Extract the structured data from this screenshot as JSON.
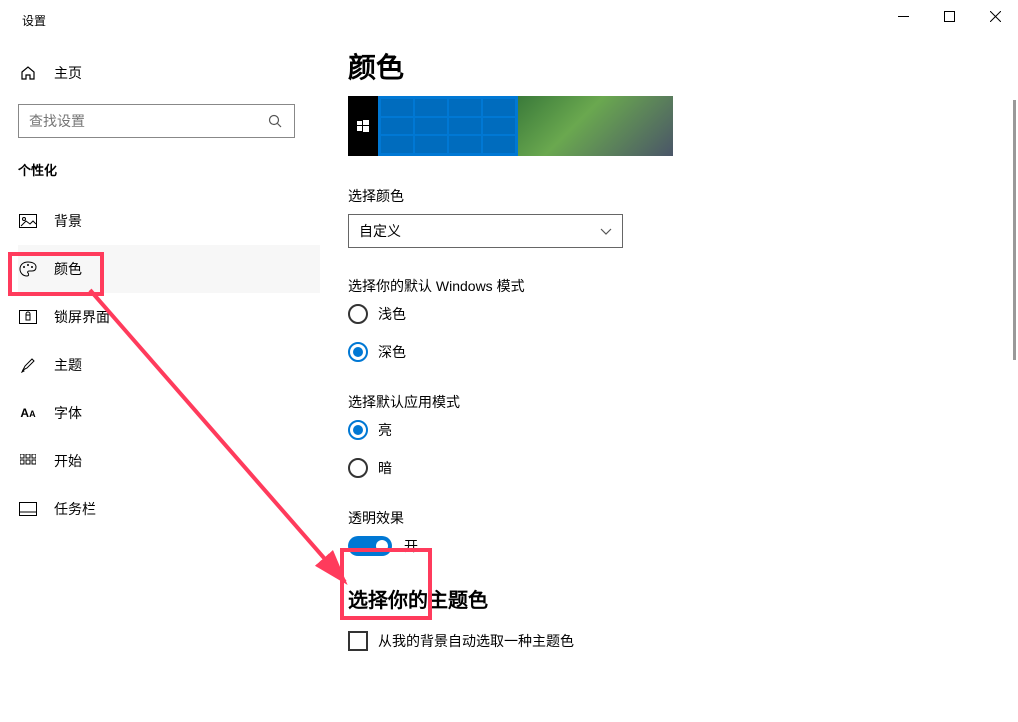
{
  "window": {
    "title": "设置"
  },
  "sidebar": {
    "home": "主页",
    "search_placeholder": "查找设置",
    "section": "个性化",
    "items": [
      {
        "label": "背景"
      },
      {
        "label": "颜色"
      },
      {
        "label": "锁屏界面"
      },
      {
        "label": "主题"
      },
      {
        "label": "字体"
      },
      {
        "label": "开始"
      },
      {
        "label": "任务栏"
      }
    ]
  },
  "main": {
    "title": "颜色",
    "choose_color_label": "选择颜色",
    "choose_color_value": "自定义",
    "win_mode_label": "选择你的默认 Windows 模式",
    "light": "浅色",
    "dark": "深色",
    "app_mode_label": "选择默认应用模式",
    "bright": "亮",
    "darkapp": "暗",
    "transparency_label": "透明效果",
    "transparency_state": "开",
    "accent_heading": "选择你的主题色",
    "auto_pick": "从我的背景自动选取一种主题色"
  }
}
